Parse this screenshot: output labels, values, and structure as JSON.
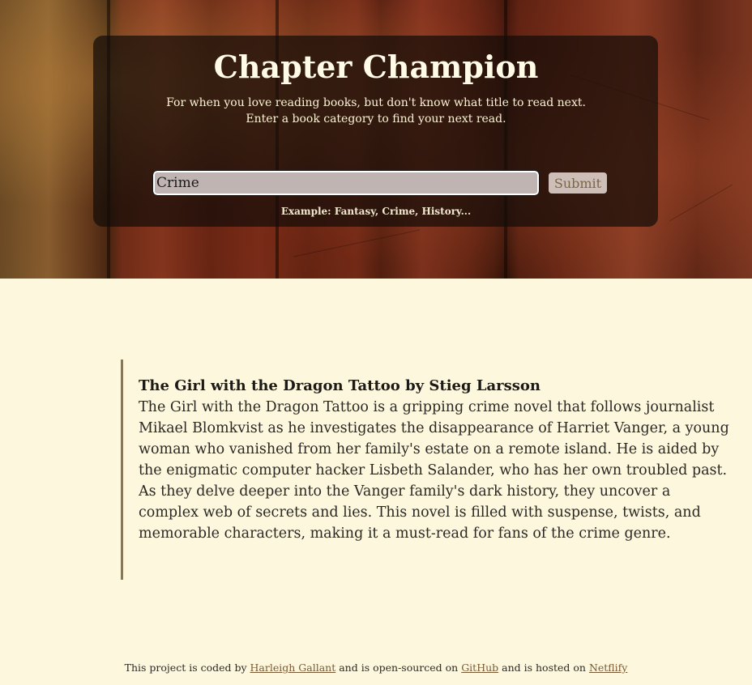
{
  "header": {
    "title": "Chapter Champion",
    "subtitle_line1": "For when you love reading books, but don't know what title to read next.",
    "subtitle_line2": "Enter a book category to find your next read."
  },
  "search": {
    "value": "Crime",
    "submit_label": "Submit",
    "hint": "Example: Fantasy, Crime, History..."
  },
  "result": {
    "title": "The Girl with the Dragon Tattoo by Stieg Larsson",
    "description": "The Girl with the Dragon Tattoo is a gripping crime novel that follows journalist Mikael Blomkvist as he investigates the disappearance of Harriet Vanger, a young woman who vanished from her family's estate on a remote island. He is aided by the enigmatic computer hacker Lisbeth Salander, who has her own troubled past. As they delve deeper into the Vanger family's dark history, they uncover a complex web of secrets and lies. This novel is filled with suspense, twists, and memorable characters, making it a must-read for fans of the crime genre."
  },
  "footer": {
    "text1": "This project is coded by ",
    "author_link": "Harleigh Gallant",
    "text2": " and is open-sourced on ",
    "github_link": "GitHub",
    "text3": " and is hosted on ",
    "host_link": "Netflify"
  },
  "colors": {
    "page_background": "#fdf7dd",
    "accent_border": "#8a7752",
    "link": "#7a5a34"
  }
}
